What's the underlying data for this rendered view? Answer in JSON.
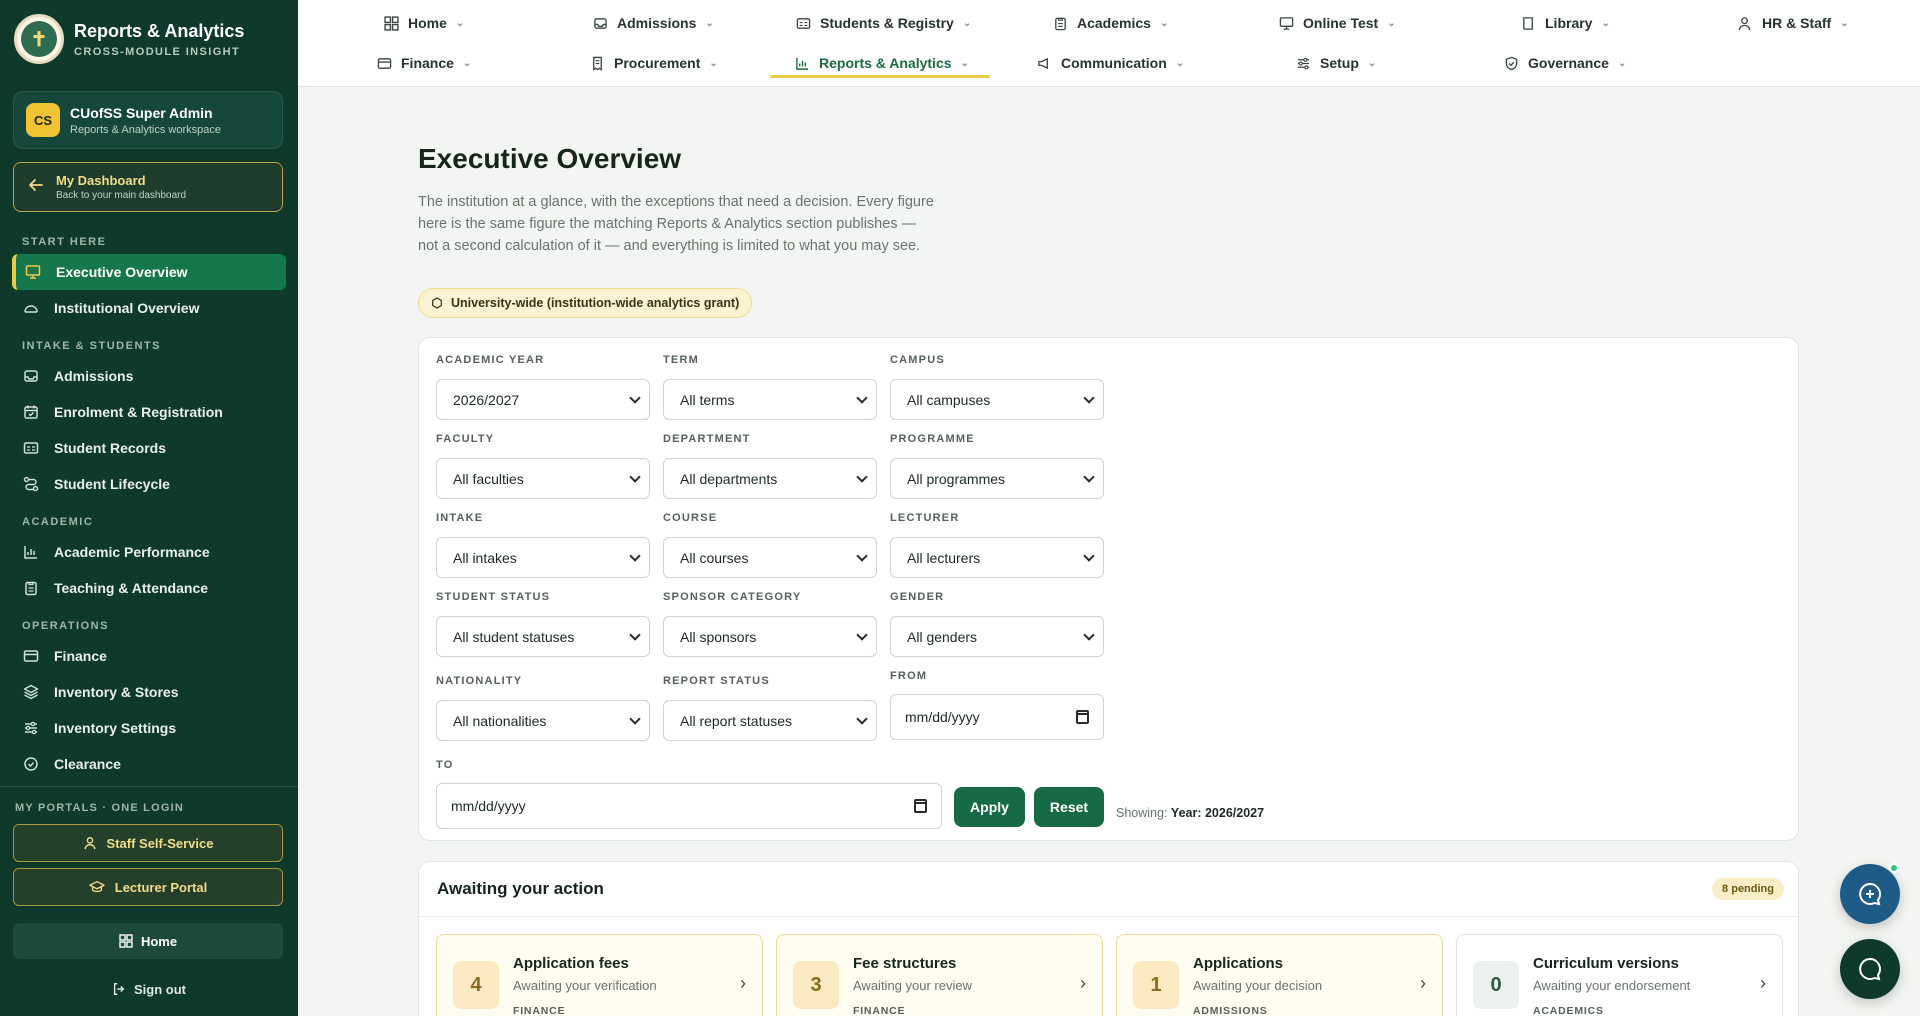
{
  "brand": {
    "title": "Reports & Analytics",
    "subtitle": "CROSS-MODULE INSIGHT"
  },
  "user": {
    "initials": "CS",
    "name": "CUofSS Super Admin",
    "role": "Reports & Analytics workspace"
  },
  "dashboard_link": {
    "title": "My Dashboard",
    "subtitle": "Back to your main dashboard"
  },
  "sidebar": {
    "sections": [
      {
        "label": "START HERE"
      },
      {
        "label": "INTAKE & STUDENTS"
      },
      {
        "label": "ACADEMIC"
      },
      {
        "label": "OPERATIONS"
      }
    ],
    "items": [
      {
        "label": "Executive Overview"
      },
      {
        "label": "Institutional Overview"
      },
      {
        "label": "Admissions"
      },
      {
        "label": "Enrolment & Registration"
      },
      {
        "label": "Student Records"
      },
      {
        "label": "Student Lifecycle"
      },
      {
        "label": "Academic Performance"
      },
      {
        "label": "Teaching & Attendance"
      },
      {
        "label": "Finance"
      },
      {
        "label": "Inventory & Stores"
      },
      {
        "label": "Inventory Settings"
      },
      {
        "label": "Clearance"
      }
    ]
  },
  "portals": {
    "label": "MY PORTALS · ONE LOGIN",
    "staff": "Staff Self-Service",
    "lecturer": "Lecturer Portal",
    "home": "Home",
    "signout": "Sign out"
  },
  "topnav": {
    "row1": [
      {
        "label": "Home"
      },
      {
        "label": "Admissions"
      },
      {
        "label": "Students & Registry"
      },
      {
        "label": "Academics"
      },
      {
        "label": "Online Test"
      },
      {
        "label": "Library"
      },
      {
        "label": "HR & Staff"
      }
    ],
    "row2": [
      {
        "label": "Finance"
      },
      {
        "label": "Procurement"
      },
      {
        "label": "Reports & Analytics"
      },
      {
        "label": "Communication"
      },
      {
        "label": "Setup"
      },
      {
        "label": "Governance"
      }
    ]
  },
  "page": {
    "title": "Executive Overview",
    "description": "The institution at a glance, with the exceptions that need a decision. Every figure here is the same figure the matching Reports & Analytics section publishes — not a second calculation of it — and everything is limited to what you may see.",
    "scope": "University-wide (institution-wide analytics grant)"
  },
  "filters": {
    "academic_year": {
      "label": "ACADEMIC YEAR",
      "value": "2026/2027"
    },
    "term": {
      "label": "TERM",
      "value": "All terms"
    },
    "campus": {
      "label": "CAMPUS",
      "value": "All campuses"
    },
    "faculty": {
      "label": "FACULTY",
      "value": "All faculties"
    },
    "department": {
      "label": "DEPARTMENT",
      "value": "All departments"
    },
    "programme": {
      "label": "PROGRAMME",
      "value": "All programmes"
    },
    "intake": {
      "label": "INTAKE",
      "value": "All intakes"
    },
    "course": {
      "label": "COURSE",
      "value": "All courses"
    },
    "lecturer": {
      "label": "LECTURER",
      "value": "All lecturers"
    },
    "student_status": {
      "label": "STUDENT STATUS",
      "value": "All student statuses"
    },
    "sponsor": {
      "label": "SPONSOR CATEGORY",
      "value": "All sponsors"
    },
    "gender": {
      "label": "GENDER",
      "value": "All genders"
    },
    "nationality": {
      "label": "NATIONALITY",
      "value": "All nationalities"
    },
    "report_status": {
      "label": "REPORT STATUS",
      "value": "All report statuses"
    },
    "from": {
      "label": "FROM",
      "placeholder": "mm/dd/yyyy"
    },
    "to": {
      "label": "TO",
      "placeholder": "mm/dd/yyyy"
    },
    "apply": "Apply",
    "reset": "Reset",
    "showing_prefix": "Showing:",
    "showing_value": "Year: 2026/2027"
  },
  "awaiting": {
    "title": "Awaiting your action",
    "badge": "8 pending",
    "cards": [
      {
        "count": "4",
        "title": "Application fees",
        "subtitle": "Awaiting your verification",
        "tag": "FINANCE"
      },
      {
        "count": "3",
        "title": "Fee structures",
        "subtitle": "Awaiting your review",
        "tag": "FINANCE"
      },
      {
        "count": "1",
        "title": "Applications",
        "subtitle": "Awaiting your decision",
        "tag": "ADMISSIONS"
      },
      {
        "count": "0",
        "title": "Curriculum versions",
        "subtitle": "Awaiting your endorsement",
        "tag": "ACADEMICS"
      }
    ]
  },
  "colors": {
    "sidebar": "#0f3a2b",
    "accent": "#176b44",
    "gold": "#f0c945"
  }
}
